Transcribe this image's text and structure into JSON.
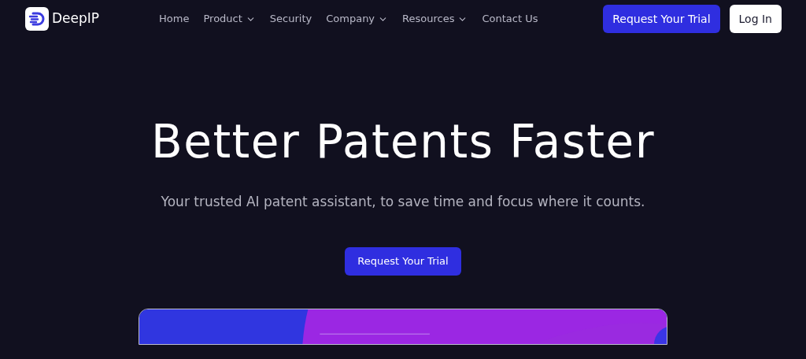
{
  "brand": {
    "name": "DeepIP"
  },
  "nav": [
    {
      "label": "Home",
      "dropdown": false
    },
    {
      "label": "Product",
      "dropdown": true
    },
    {
      "label": "Security",
      "dropdown": false
    },
    {
      "label": "Company",
      "dropdown": true
    },
    {
      "label": "Resources",
      "dropdown": true
    },
    {
      "label": "Contact Us",
      "dropdown": false
    }
  ],
  "header_buttons": [
    {
      "label": "Request Your Trial",
      "kind": "primary"
    },
    {
      "label": "Log In",
      "kind": "secondary"
    }
  ],
  "hero": {
    "title": "Better Patents Faster",
    "subtitle": "Your trusted AI patent assistant, to save time and focus where it counts.",
    "cta": "Request Your Trial"
  }
}
